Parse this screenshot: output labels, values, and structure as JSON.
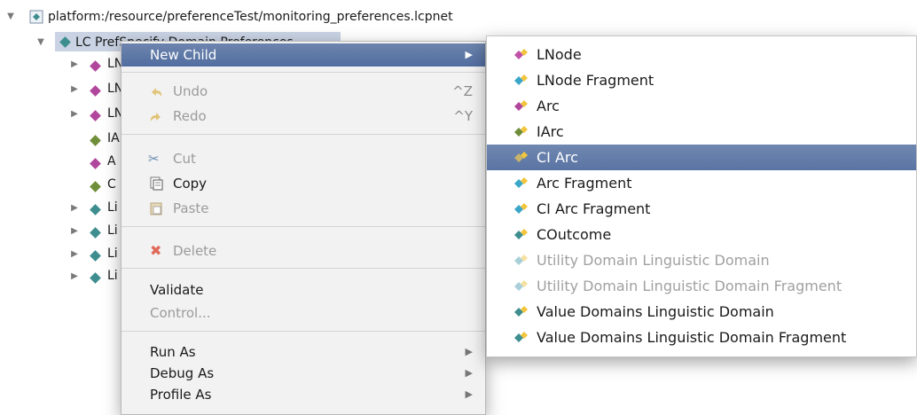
{
  "tree": {
    "root_label": "platform:/resource/preferenceTest/monitoring_preferences.lcpnet",
    "selected_label": "LC PrefSpecify Domain Preferences",
    "children": [
      {
        "label": "LN"
      },
      {
        "label": "LN"
      },
      {
        "label": "LN"
      },
      {
        "label": "IA"
      },
      {
        "label": "A"
      },
      {
        "label": "C"
      },
      {
        "label": "Li"
      },
      {
        "label": "Li"
      },
      {
        "label": "Li"
      },
      {
        "label": "Li"
      }
    ]
  },
  "context_menu": {
    "new_child": "New Child",
    "undo": "Undo",
    "undo_shortcut": "^Z",
    "redo": "Redo",
    "redo_shortcut": "^Y",
    "cut": "Cut",
    "copy": "Copy",
    "paste": "Paste",
    "delete": "Delete",
    "validate": "Validate",
    "control": "Control...",
    "run_as": "Run As",
    "debug_as": "Debug As",
    "profile_as": "Profile As"
  },
  "submenu": {
    "items": [
      {
        "label": "LNode",
        "enabled": true
      },
      {
        "label": "LNode Fragment",
        "enabled": true
      },
      {
        "label": "Arc",
        "enabled": true
      },
      {
        "label": "IArc",
        "enabled": true
      },
      {
        "label": "CI Arc",
        "enabled": true,
        "selected": true
      },
      {
        "label": "Arc Fragment",
        "enabled": true
      },
      {
        "label": "CI Arc Fragment",
        "enabled": true
      },
      {
        "label": "COutcome",
        "enabled": true
      },
      {
        "label": "Utility Domain Linguistic Domain",
        "enabled": false
      },
      {
        "label": "Utility Domain Linguistic Domain Fragment",
        "enabled": false
      },
      {
        "label": "Value Domains Linguistic Domain",
        "enabled": true
      },
      {
        "label": "Value Domains Linguistic Domain Fragment",
        "enabled": true
      }
    ]
  },
  "colors": {
    "highlight": "#5a74a4",
    "tree_selection": "#c9d3e3"
  }
}
